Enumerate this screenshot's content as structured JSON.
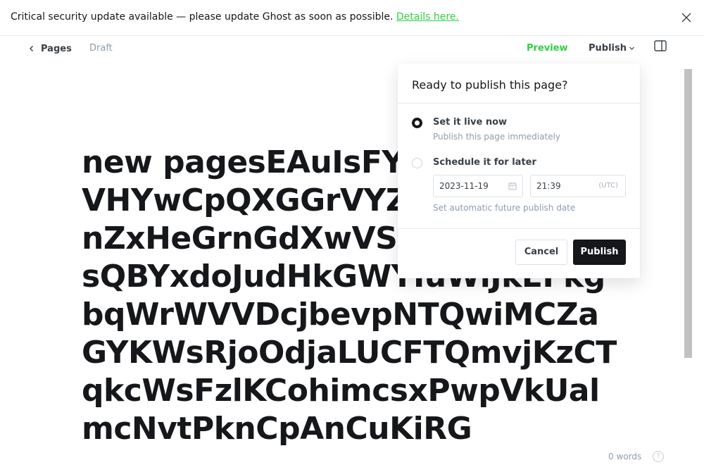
{
  "banner": {
    "message": "Critical security update available — please update Ghost as soon as possible. ",
    "link_text": "Details here."
  },
  "header": {
    "back_label": "Pages",
    "status": "Draft",
    "preview_label": "Preview",
    "publish_label": "Publish"
  },
  "editor": {
    "title": "new pagesEAuIsFYgyYbVxzgwVHYwCpQXGGrVYZbsSmpMhKnZxHeGrnGdXwVSHQTrYIKSZGsQBYxdoJudHkGWYIuWlJkEFkgbqWrWVVDcjbevpNTQwiMCZaGYKWsRjoOdjaLUCFTQmvjKzCTqkcWsFzlKCohimcsxPwpVkUalmcNvtPknCpAnCuKiRG",
    "word_count": "0 words",
    "help_label": "?"
  },
  "publish_popover": {
    "title": "Ready to publish this page?",
    "option_now": {
      "label": "Set it live now",
      "description": "Publish this page immediately"
    },
    "option_schedule": {
      "label": "Schedule it for later",
      "date_value": "2023-11-19",
      "time_value": "21:39",
      "timezone": "(UTC)",
      "description": "Set automatic future publish date"
    },
    "cancel_label": "Cancel",
    "publish_label": "Publish"
  },
  "colors": {
    "accent_green": "#30cf43",
    "button_dark": "#15171a"
  }
}
